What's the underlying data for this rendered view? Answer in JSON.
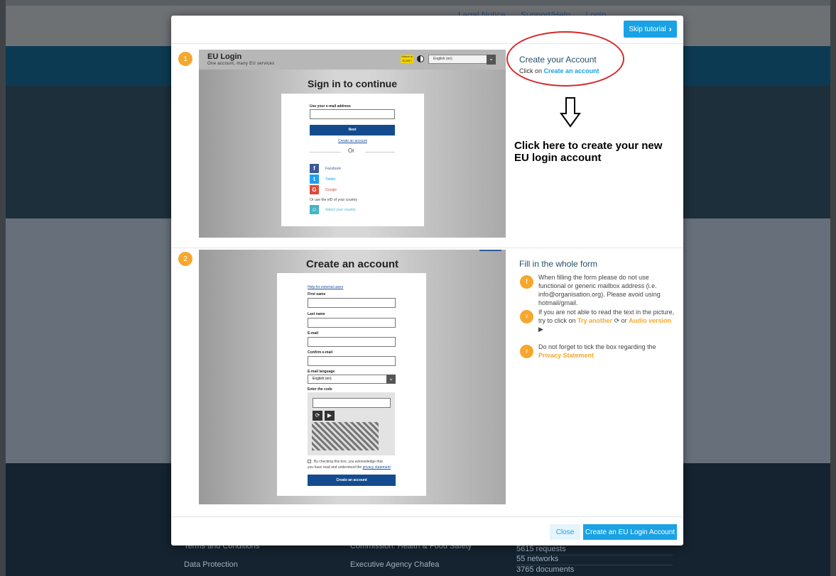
{
  "background": {
    "top_links": [
      "Legal Notice",
      "Support/Help",
      "Login"
    ],
    "footer": {
      "col1": [
        "Terms and Conditions",
        "Data Protection"
      ],
      "col2": [
        "Commission: Health & Food Safety",
        "Executive Agency Chafea"
      ],
      "col3": [
        "5615 requests",
        "55 networks",
        "3765 documents"
      ]
    }
  },
  "modal": {
    "skip_label": "Skip tutorial",
    "step1": {
      "number": "1",
      "shot": {
        "brand": "EU Login",
        "tagline": "One account, many EU services",
        "ecas": "Where is ECAS?",
        "language": "English (en)",
        "title": "Sign in to continue",
        "email_label": "Use your e-mail address",
        "next": "Next",
        "create_link": "Create an account",
        "or": "Or",
        "facebook": "Facebook",
        "twitter": "Twitter",
        "google": "Google",
        "eid_text": "Or use the eID of your country",
        "select_country": "Select your country"
      },
      "title": "Create your Account",
      "instruction_prefix": "Click on",
      "instruction_link": "Create an account",
      "annotation": "Click here to create your new EU login account"
    },
    "step2": {
      "number": "2",
      "shot": {
        "title": "Create an account",
        "help_link": "Help for external users",
        "first_name": "First name",
        "last_name": "Last name",
        "email": "E-mail",
        "confirm_email": "Confirm e-mail",
        "email_language": "E-mail language",
        "language_value": "English (en)",
        "enter_code": "Enter the code",
        "consent_text_1": "By checking this box, you acknowledge that",
        "consent_text_2": "you have read and understood the",
        "privacy_link": "privacy statement",
        "create_button": "Create an account"
      },
      "title": "Fill in the whole form",
      "tip1": "When filling the form please do not use functional or generic mailbox address (i.e. info@organisation.org). Please avoid using hotmail/gmail.",
      "tip2_prefix": "If you are not able to read the text in the picture, try to click on",
      "tip2_link1": "Try another",
      "tip2_mid": "or",
      "tip2_link2": "Audio version",
      "tip3_prefix": "Do not forget to tick the box regarding the",
      "tip3_link": "Privacy Statement"
    },
    "footer": {
      "close": "Close",
      "create": "Create an EU Login Account"
    }
  },
  "colors": {
    "accent": "#1aa2e4",
    "step_badge": "#f6a72d",
    "annotation_red": "#d42a2a"
  }
}
